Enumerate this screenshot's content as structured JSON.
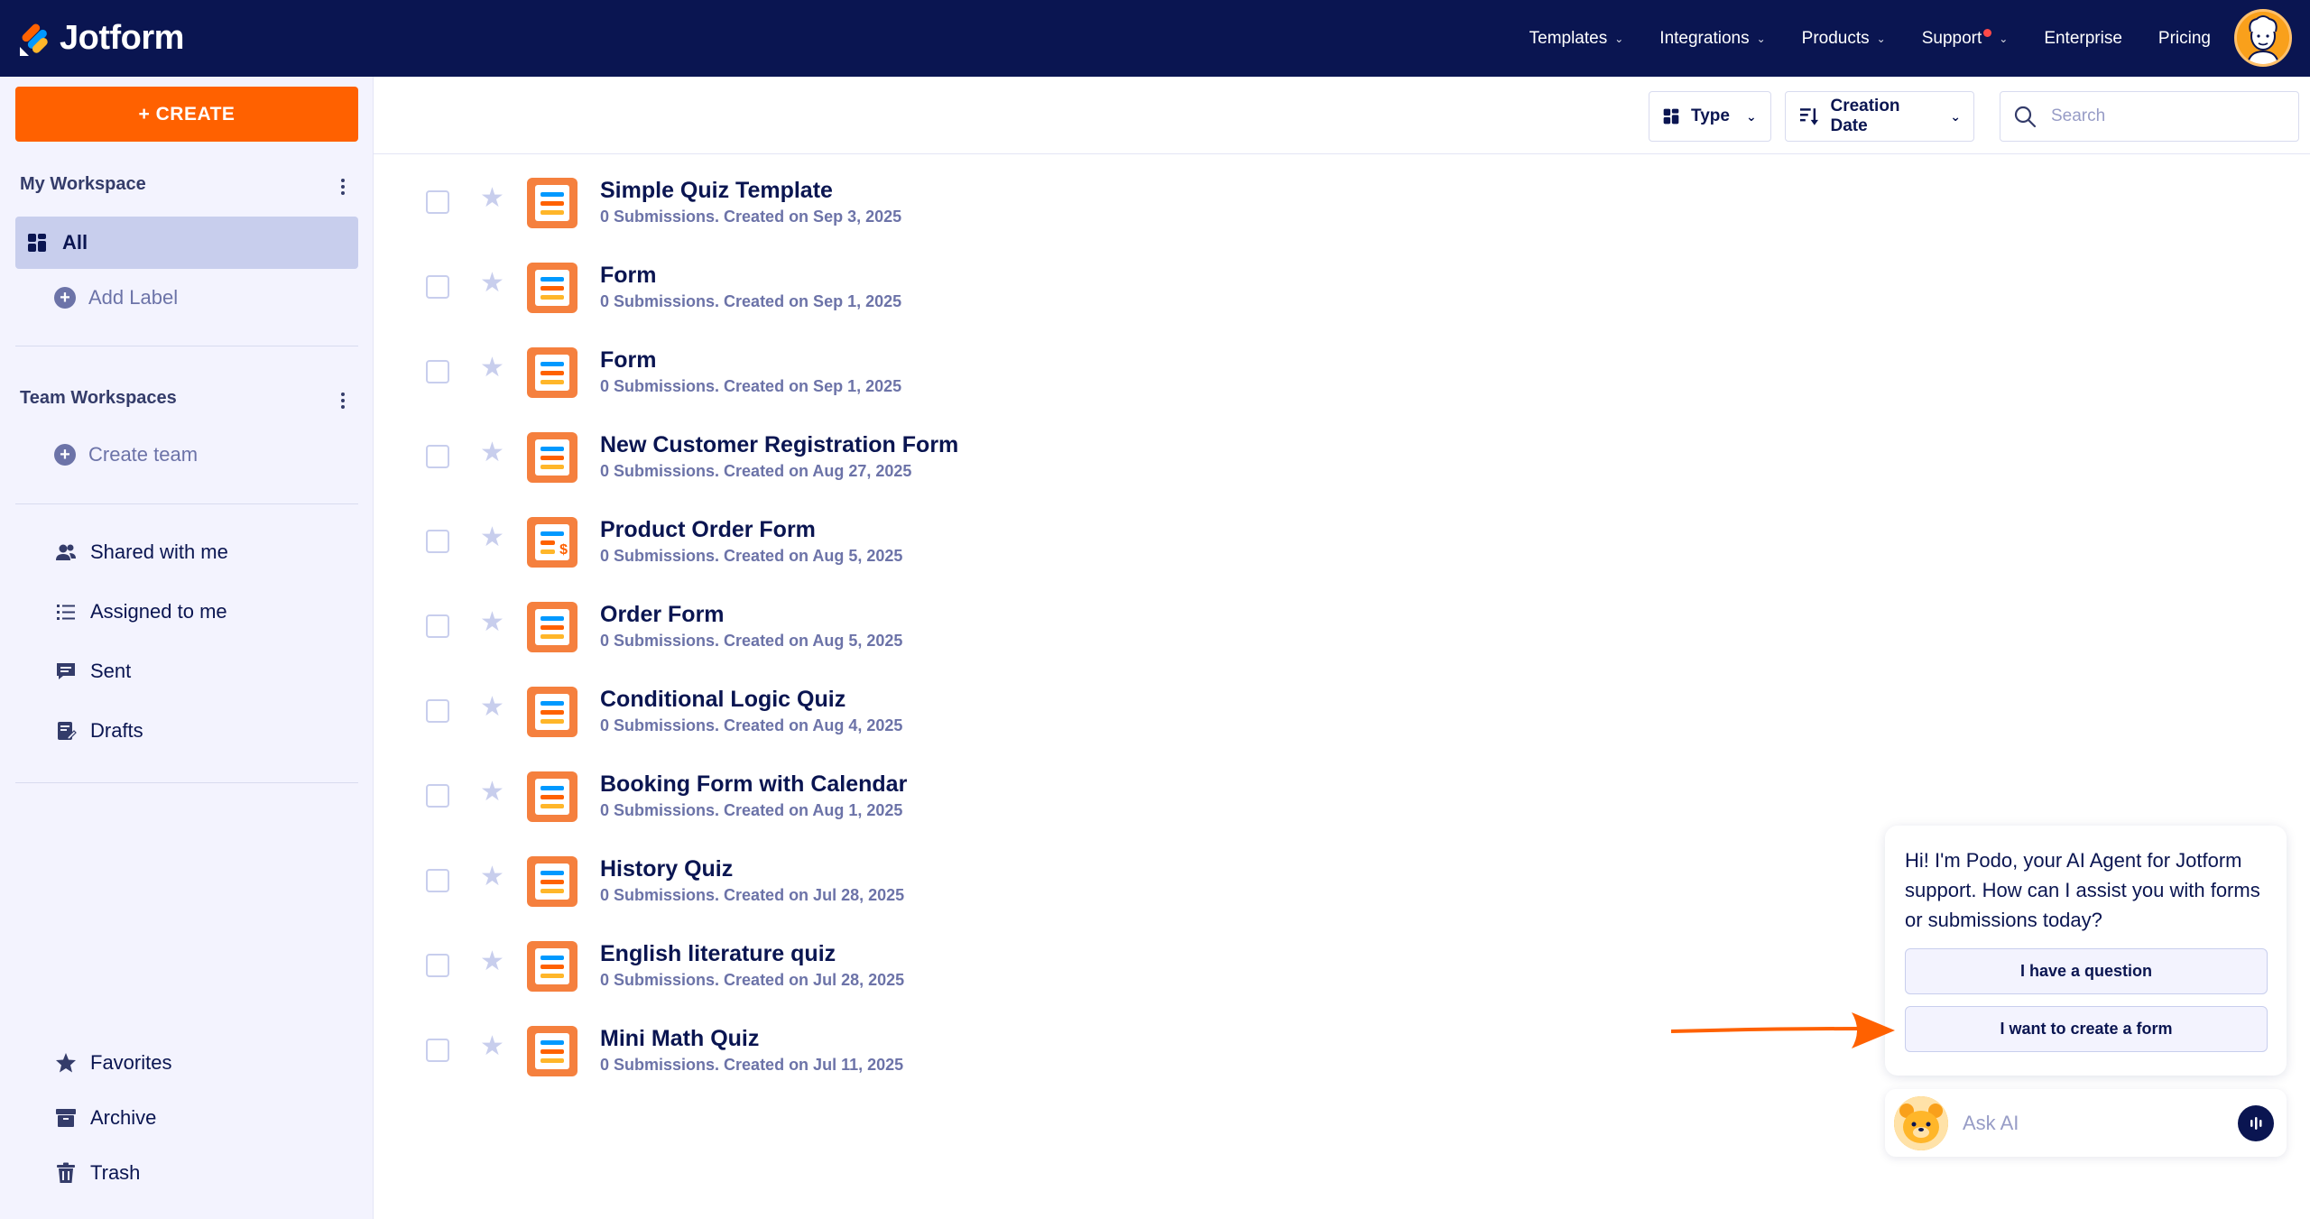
{
  "brand": {
    "name": "Jotform"
  },
  "nav": {
    "links": [
      {
        "label": "Templates",
        "has_menu": true
      },
      {
        "label": "Integrations",
        "has_menu": true
      },
      {
        "label": "Products",
        "has_menu": true
      },
      {
        "label": "Support",
        "has_menu": true,
        "has_dot": true
      },
      {
        "label": "Enterprise",
        "has_menu": false
      },
      {
        "label": "Pricing",
        "has_menu": false
      }
    ]
  },
  "sidebar": {
    "create_label": "+ CREATE",
    "my_workspace": "My Workspace",
    "all_label": "All",
    "add_label": "Add Label",
    "team_workspaces": "Team Workspaces",
    "create_team": "Create team",
    "items": [
      {
        "label": "Shared with me",
        "icon": "shared-users-icon"
      },
      {
        "label": "Assigned to me",
        "icon": "assigned-list-icon"
      },
      {
        "label": "Sent",
        "icon": "sent-message-icon"
      },
      {
        "label": "Drafts",
        "icon": "drafts-icon"
      }
    ],
    "bottom_items": [
      {
        "label": "Favorites",
        "icon": "star-icon"
      },
      {
        "label": "Archive",
        "icon": "archive-icon"
      },
      {
        "label": "Trash",
        "icon": "trash-icon"
      }
    ]
  },
  "toolbar": {
    "type_label": "Type",
    "sort_label": "Creation Date",
    "search_placeholder": "Search"
  },
  "forms": [
    {
      "title": "Simple Quiz Template",
      "meta": "0 Submissions. Created on Sep 3, 2025",
      "variant": "form"
    },
    {
      "title": "Form",
      "meta": "0 Submissions. Created on Sep 1, 2025",
      "variant": "form"
    },
    {
      "title": "Form",
      "meta": "0 Submissions. Created on Sep 1, 2025",
      "variant": "form"
    },
    {
      "title": "New Customer Registration Form",
      "meta": "0 Submissions. Created on Aug 27, 2025",
      "variant": "form"
    },
    {
      "title": "Product Order Form",
      "meta": "0 Submissions. Created on Aug 5, 2025",
      "variant": "payment"
    },
    {
      "title": "Order Form",
      "meta": "0 Submissions. Created on Aug 5, 2025",
      "variant": "form"
    },
    {
      "title": "Conditional Logic Quiz",
      "meta": "0 Submissions. Created on Aug 4, 2025",
      "variant": "form"
    },
    {
      "title": "Booking Form with Calendar",
      "meta": "0 Submissions. Created on Aug 1, 2025",
      "variant": "form"
    },
    {
      "title": "History Quiz",
      "meta": "0 Submissions. Created on Jul 28, 2025",
      "variant": "form"
    },
    {
      "title": "English literature quiz",
      "meta": "0 Submissions. Created on Jul 28, 2025",
      "variant": "form"
    },
    {
      "title": "Mini Math Quiz",
      "meta": "0 Submissions. Created on Jul 11, 2025",
      "variant": "form"
    }
  ],
  "chat": {
    "message": "Hi! I'm Podo, your AI Agent for Jotform support. How can I assist you with forms or submissions today?",
    "option_1": "I have a question",
    "option_2": "I want to create a form",
    "input_placeholder": "Ask AI"
  },
  "colors": {
    "navy": "#0a1551",
    "orange": "#ff6100",
    "form_icon": "#f5803e",
    "sidebar_bg": "#f3f3fe",
    "selected": "#c8ceed"
  }
}
